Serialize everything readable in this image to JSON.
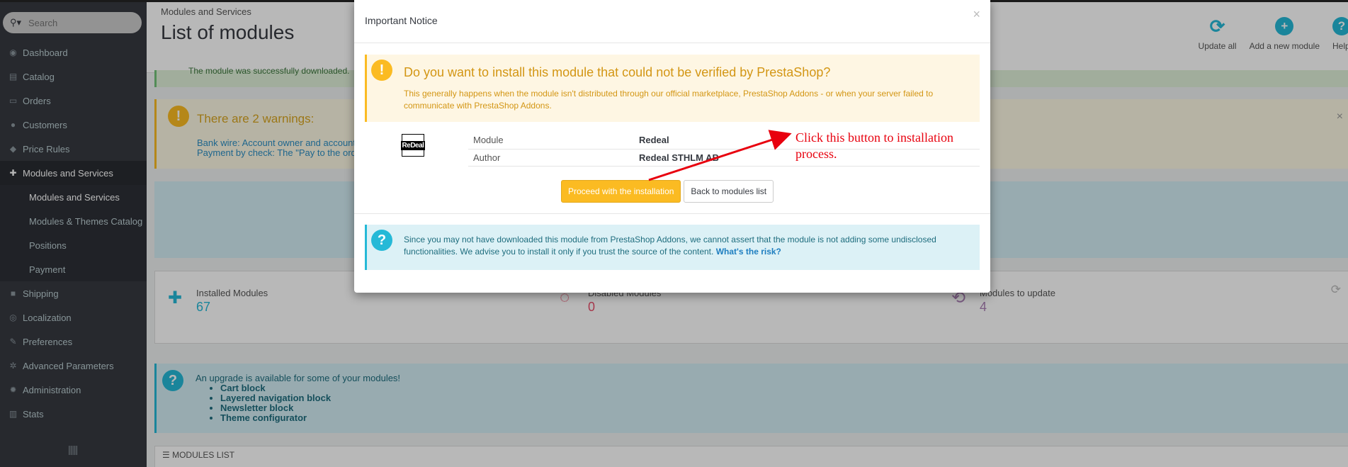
{
  "sidebar": {
    "search_placeholder": "Search",
    "items": [
      {
        "label": "Dashboard",
        "icon": "dashboard-icon",
        "glyph": "◉"
      },
      {
        "label": "Catalog",
        "icon": "catalog-icon",
        "glyph": "▤"
      },
      {
        "label": "Orders",
        "icon": "orders-icon",
        "glyph": "▭"
      },
      {
        "label": "Customers",
        "icon": "customers-icon",
        "glyph": "●"
      },
      {
        "label": "Price Rules",
        "icon": "price-rules-icon",
        "glyph": "◆"
      },
      {
        "label": "Modules and Services",
        "icon": "puzzle-icon",
        "glyph": "✚"
      }
    ],
    "subitems": [
      "Modules and Services",
      "Modules & Themes Catalog",
      "Positions",
      "Payment"
    ],
    "items2": [
      {
        "label": "Shipping",
        "icon": "truck-icon",
        "glyph": "■"
      },
      {
        "label": "Localization",
        "icon": "globe-icon",
        "glyph": "◎"
      },
      {
        "label": "Preferences",
        "icon": "wrench-icon",
        "glyph": "✎"
      },
      {
        "label": "Advanced Parameters",
        "icon": "cogs-icon",
        "glyph": "✲"
      },
      {
        "label": "Administration",
        "icon": "gear-icon",
        "glyph": "✹"
      },
      {
        "label": "Stats",
        "icon": "bar-chart-icon",
        "glyph": "▥"
      }
    ],
    "collapse_glyph": "|||||"
  },
  "header": {
    "breadcrumb": "Modules and Services",
    "title": "List of modules",
    "toolbar": {
      "update_all": "Update all",
      "add_module": "Add a new module",
      "help": "Help"
    }
  },
  "background": {
    "success_text": "The module was successfully downloaded.",
    "warning_title": "There are 2 warnings:",
    "warning_lines": [
      "Bank wire: Account owner and account details must be configured before using this module.",
      "Payment by check: The \"Pay to the order of\" and \"Address\" fields must be configured before using this module."
    ],
    "kpis": [
      {
        "label": "Installed Modules",
        "value": "67",
        "color": "#25b9d7"
      },
      {
        "label": "Disabled Modules",
        "value": "0",
        "color": "#e84e6a"
      },
      {
        "label": "Modules to update",
        "value": "4",
        "color": "#a97eb4"
      }
    ],
    "upgrade_text": "An upgrade is available for some of your modules!",
    "upgrade_items": [
      "Cart block",
      "Layered navigation block",
      "Newsletter block",
      "Theme configurator"
    ],
    "modules_list_title": "Modules list"
  },
  "modal": {
    "title": "Important Notice",
    "close": "×",
    "warning_title": "Do you want to install this module that could not be verified by PrestaShop?",
    "warning_text": "This generally happens when the module isn't distributed through our official marketplace, PrestaShop Addons - or when your server failed to communicate with PrestaShop Addons.",
    "logo_text": "ReDeal",
    "rows": [
      {
        "label": "Module",
        "value": "Redeal"
      },
      {
        "label": "Author",
        "value": "Redeal STHLM AB"
      }
    ],
    "proceed_button": "Proceed with the installation",
    "back_button": "Back to modules list",
    "info_text": "Since you may not have downloaded this module from PrestaShop Addons, we cannot assert that the module is not adding some undisclosed functionalities. We advise you to install it only if you trust the source of the content.",
    "info_link": "What's the risk?"
  },
  "annotation": {
    "text": "Click this button to installation process.",
    "color": "#e8000e"
  },
  "colors": {
    "sidebar_bg": "#363a41",
    "accent": "#25b9d7",
    "warning": "#fbbb22"
  }
}
